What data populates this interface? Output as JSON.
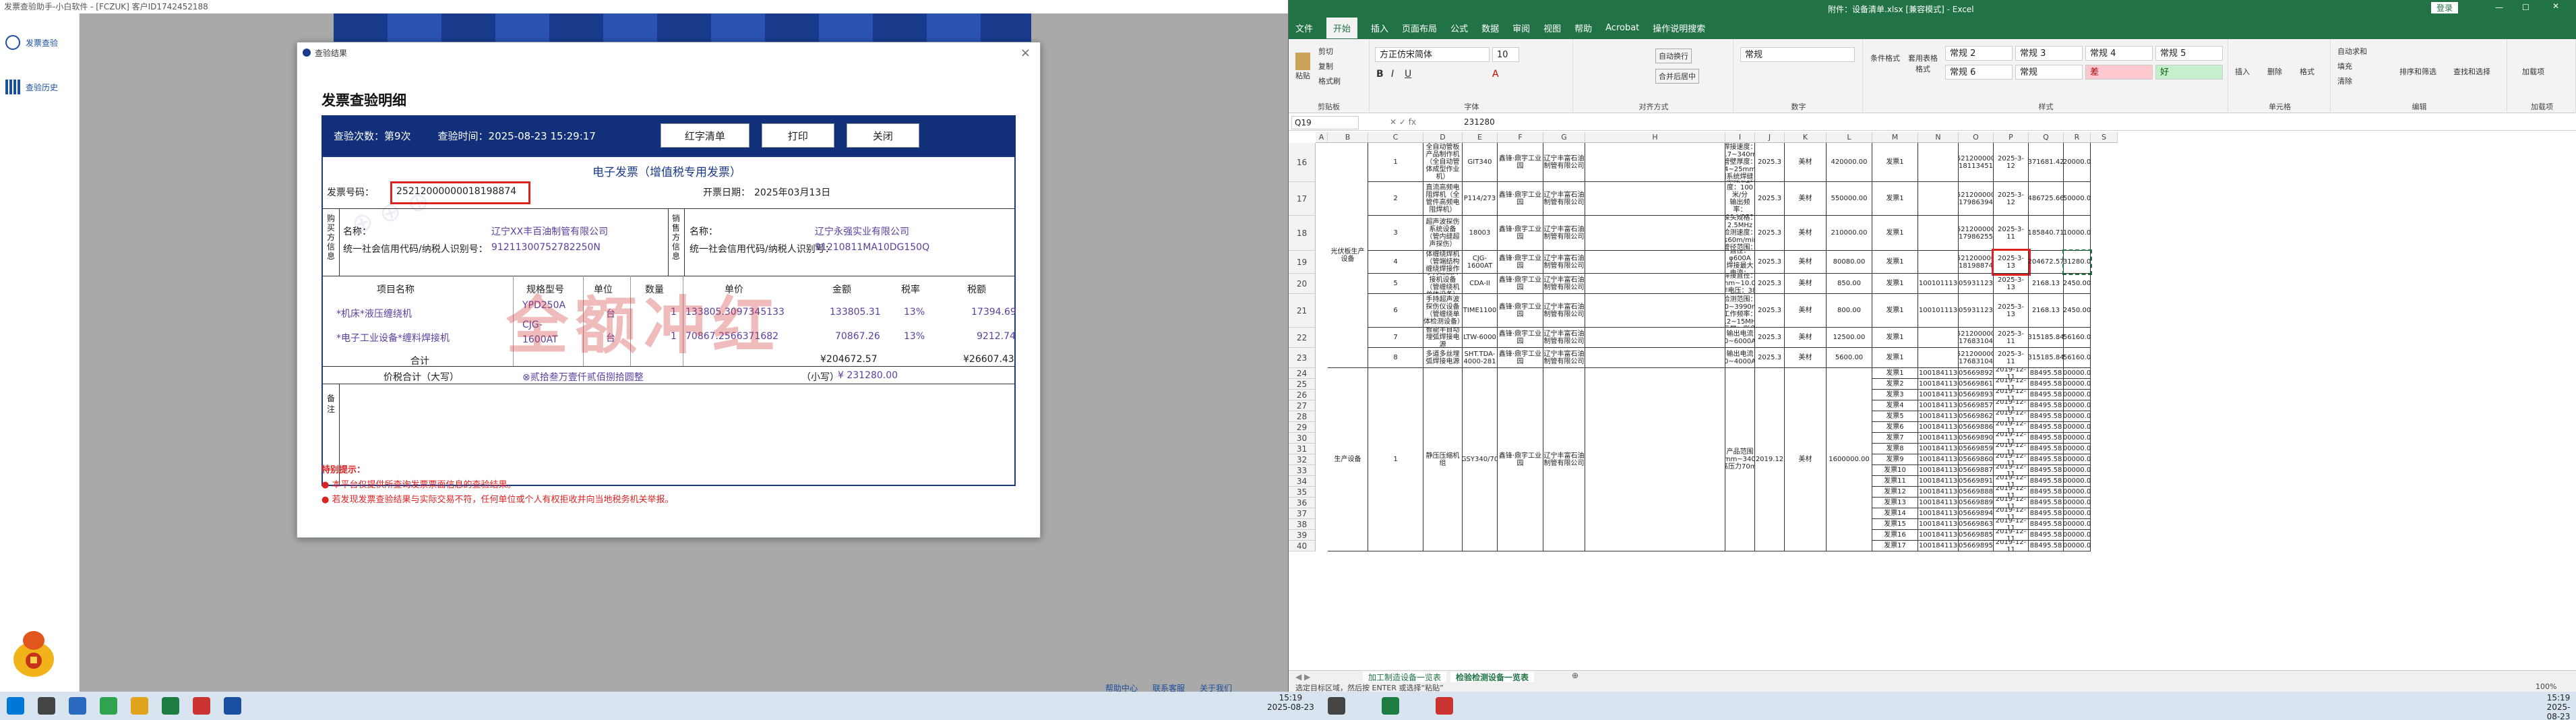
{
  "left_window": {
    "title": "发票查验助手-小白软件 - [FCZUK] 客户ID1742452188",
    "nav": [
      {
        "label": "发票查验"
      },
      {
        "label": "查验历史"
      }
    ],
    "links": [
      "帮助中心",
      "联系客服",
      "关于我们"
    ]
  },
  "dialog": {
    "title": "查验结果",
    "heading": "发票查验明细",
    "check_count_label": "查验次数：第9次",
    "check_time_label": "查验时间：2025-08-23 15:29:17",
    "buttons": {
      "list": "红字清单",
      "print": "打印",
      "close": "关闭"
    },
    "invoice": {
      "title": "电子发票（增值税专用发票）",
      "number_label": "发票号码：",
      "number": "25212000000018198874",
      "date_label": "开票日期：",
      "date": "2025年03月13日",
      "buyer_label": "购买方信息",
      "seller_label": "销售方信息",
      "name_label": "名称：",
      "tax_label": "统一社会信用代码/纳税人识别号：",
      "buyer_name": "辽宁XX丰百油制管有限公司",
      "buyer_tax": "91211300752782250N",
      "seller_name": "辽宁永强实业有限公司",
      "seller_tax": "91210811MA10DG150Q",
      "headers": [
        "项目名称",
        "规格型号",
        "单位",
        "数量",
        "单价",
        "金额",
        "税率",
        "税额"
      ],
      "items": [
        {
          "name": "*机床*液压缠绕机",
          "spec": "YPD250A",
          "unit": "台",
          "qty": "1",
          "price": "133805.3097345133",
          "amount": "133805.31",
          "rate": "13%",
          "tax": "17394.69"
        },
        {
          "name": "*电子工业设备*缠料焊接机",
          "spec": "CJG-1600AT",
          "unit": "台",
          "qty": "1",
          "price": "70867.2566371682",
          "amount": "70867.26",
          "rate": "13%",
          "tax": "9212.74"
        }
      ],
      "total_label": "合计",
      "total_amount": "¥204672.57",
      "total_tax": "¥26607.43",
      "grand_label": "价税合计（大写）",
      "grand_words": "⊗贰拾叁万壹仟贰佰捌拾圆整",
      "grand_small_label": "（小写）",
      "grand_small": "¥ 231280.00",
      "remark_label": "备注",
      "watermark": "全额冲红"
    },
    "notice_title": "特别提示：",
    "notices": [
      "本平台仅提供所查询发票票面信息的查验结果。",
      "若发现发票查验结果与实际交易不符，任何单位或个人有权拒收并向当地税务机关举报。"
    ]
  },
  "excel": {
    "title": "附件：设备清单.xlsx [兼容模式] - Excel",
    "login": "登录",
    "menu": [
      "文件",
      "开始",
      "插入",
      "页面布局",
      "公式",
      "数据",
      "审阅",
      "视图",
      "帮助",
      "Acrobat",
      "操作说明搜索"
    ],
    "ribbon": {
      "font_name": "方正仿宋简体",
      "font_size": "10",
      "number_format": "常规",
      "wrap": "自动换行",
      "merge": "合并后居中",
      "styles": [
        "常规 2",
        "常规 3",
        "常规 4",
        "常规 5",
        "常规 6",
        "常规",
        "差",
        "好"
      ],
      "groups": [
        "剪贴板",
        "字体",
        "对齐方式",
        "数字",
        "样式",
        "单元格",
        "编辑",
        "加载项"
      ],
      "buttons": [
        "粘贴",
        "剪切",
        "复制",
        "格式刷",
        "条件格式",
        "套用表格格式",
        "插入",
        "删除",
        "格式",
        "自动求和",
        "填充",
        "清除",
        "排序和筛选",
        "查找和选择",
        "加载项"
      ]
    },
    "name_box": "Q19",
    "formula": "231280",
    "columns": [
      "A",
      "B",
      "C",
      "D",
      "E",
      "F",
      "G",
      "H",
      "I",
      "J",
      "K",
      "L",
      "M",
      "N",
      "O",
      "P",
      "Q",
      "R",
      "S"
    ],
    "group_label_1": "光伏板生产设备",
    "group_label_2": "生产设备",
    "rows": [
      {
        "r": "16",
        "c": "1",
        "d": "全自动管板产品制作机（全自动管体成型作业机）",
        "e": "GIT340",
        "f": "鑫锋·鼎宇工业园",
        "g": "辽宁丰富石油制管有限公司",
        "i": "焊管直径：120至7/台\n焊接速度：13.7~340mm\n管壁厚度：4~25mm\n用系统焊缝自动跟踪与转轴自动对中",
        "j": "2025.3",
        "k": "美材",
        "l": "420000.00",
        "m": "发票1",
        "o": "25212000000\n18113451",
        "p": "2025-3-12",
        "q": "371681.42",
        "rr": "420000.00"
      },
      {
        "r": "17",
        "c": "2",
        "d": "直流高频电阻焊机（全管件高频电阻焊机）",
        "e": "P114/273",
        "f": "鑫锋·鼎宇工业园",
        "g": "辽宁丰富石油制管有限公司",
        "i": "额定功率：600kW\n焊接速度：100米/分\n输出频率：114/273\n管壁厚度范围：≤200mm",
        "j": "2025.3",
        "k": "美材",
        "l": "550000.00",
        "m": "发票1",
        "o": "25212000000\n17986394",
        "p": "2025-3-12",
        "q": "486725.66",
        "rr": "550000.00"
      },
      {
        "r": "18",
        "c": "3",
        "d": "超声波探伤系统设备（管内缝超声探伤）",
        "e": "18003",
        "f": "鑫锋·鼎宇工业园",
        "g": "辽宁丰富石油制管有限公司",
        "i": "多通道：16通道\n探头规格：2.5MHz\n检测速度：≤60m/min\n管径范围：φ219~φ1420mm",
        "j": "2025.3",
        "k": "美材",
        "l": "210000.00",
        "m": "发票1",
        "o": "25212000000\n17986255",
        "p": "2025-3-11",
        "q": "185840.71",
        "rr": "210000.00"
      },
      {
        "r": "19",
        "c": "4",
        "d": "数控专用管体缠绕焊机（管端结构缠绕焊接作业）",
        "e": "CJG-1600AT",
        "f": "鑫锋·鼎宇工业园",
        "g": "辽宁丰富石油制管有限公司",
        "i": "缠绕最大直径：φ600A\n焊接最大电流：1600A",
        "j": "2025.3",
        "k": "美材",
        "l": "80080.00",
        "m": "发票1",
        "o": "25212000000\n18198874",
        "p": "2025-3-13",
        "q": "204672.57",
        "rr": "231280.00"
      },
      {
        "r": "20",
        "c": "5",
        "d": "手持缠绕焊接机设备（管缠绕机单体设备）",
        "e": "CDA-II",
        "f": "鑫锋·鼎宇工业园",
        "g": "辽宁丰富石油制管有限公司",
        "i": "焊接直径：2.0mm~10.0mm\n工作电压：380V",
        "j": "2025.3",
        "k": "美材",
        "l": "850.00",
        "m": "发票1",
        "n": "21001011130",
        "o": "05931123",
        "p": "2025-3-13",
        "q": "2168.13",
        "rr": "2450.00"
      },
      {
        "r": "21",
        "c": "6",
        "d": "手持超声波探伤仪设备（管缠绕单体检测设备）",
        "e": "TIME1100",
        "f": "鑫锋·鼎宇工业园",
        "g": "辽宁丰富石油制管有限公司",
        "i": "检测速度：2.5~5000mm\n检测范围：100~3990m/s\n工作频率：0.2~15MHz\n显示屏：彩色液晶",
        "j": "2025.3",
        "k": "美材",
        "l": "800.00",
        "m": "发票1",
        "n": "21001011130",
        "o": "05931123",
        "p": "2025-3-13",
        "q": "2168.13",
        "rr": "2450.00"
      },
      {
        "r": "22",
        "c": "7",
        "d": "智能半自动埋弧焊接电源",
        "e": "LTW-6000",
        "f": "鑫锋·鼎宇工业园",
        "g": "辽宁丰富石油制管有限公司",
        "i": "输出电流0~6000A",
        "j": "2025.3",
        "k": "美材",
        "l": "12500.00",
        "m": "发票1",
        "o": "25212000000\n17683104",
        "p": "2025-3-11",
        "q": "315185.84",
        "rr": "356160.00"
      },
      {
        "r": "23",
        "c": "8",
        "d": "多道多丝埋弧焊接电源",
        "e": "SHT.TDA-4000-281",
        "f": "鑫锋·鼎宇工业园",
        "g": "辽宁丰富石油制管有限公司",
        "i": "输出电流0~4000A",
        "j": "2025.3",
        "k": "美材",
        "l": "5600.00",
        "m": "发票1",
        "o": "25212000000\n17683104",
        "p": "2025-3-11",
        "q": "315185.84",
        "rr": "356160.00"
      }
    ],
    "big_row": {
      "c": "1",
      "d": "静压压缩机组",
      "e": "GSY340/70",
      "f": "鑫锋·鼎宇工业园",
      "g": "辽宁丰富石油制管有限公司",
      "i": "产品范围140mm~340mm 最高压力70mpa",
      "j": "2019.12",
      "k": "美材",
      "l": "1600000.00"
    },
    "sub_rows": {
      "numbers": [
        "24",
        "25",
        "26",
        "27",
        "28",
        "29",
        "30",
        "31",
        "32",
        "33",
        "34",
        "35",
        "36",
        "37",
        "38",
        "39",
        "40"
      ],
      "m": [
        "发票1",
        "发票2",
        "发票3",
        "发票4",
        "发票5",
        "发票6",
        "发票7",
        "发票8",
        "发票9",
        "发票10",
        "发票11",
        "发票12",
        "发票13",
        "发票14",
        "发票15",
        "发票16",
        "发票17"
      ],
      "n": "21001841130",
      "o": [
        "05669892",
        "05669861",
        "05669893",
        "05669857",
        "05669862",
        "05669886",
        "05669890",
        "05669859",
        "05669860",
        "05669887",
        "05669891",
        "05669888",
        "05669889",
        "05669894",
        "05669863",
        "05669885",
        "05669895"
      ],
      "p": "2019-12-11",
      "q": "88495.58",
      "rr": "100000.00"
    },
    "sheet_tabs": [
      "加工制造设备一览表",
      "检验检测设备一览表"
    ],
    "status_left": "选定目标区域，然后按 ENTER 或选择“粘贴”",
    "status_right": "100%"
  },
  "taskbar": {
    "time": "15:19",
    "date": "2025-08-23"
  }
}
